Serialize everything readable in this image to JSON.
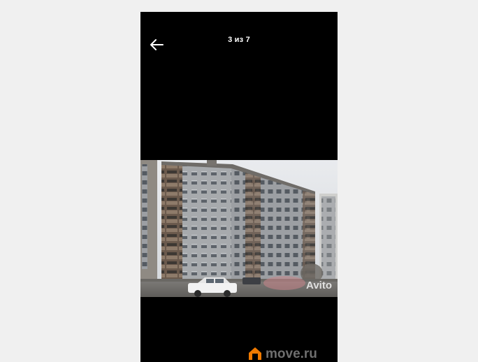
{
  "viewer": {
    "counter": "3 из 7",
    "back_icon": "arrow-left-icon"
  },
  "photo": {
    "watermark_text": "Avito"
  },
  "watermark": {
    "brand": "move.ru",
    "brand_color": "#f07a00",
    "icon": "house-logo-icon"
  }
}
